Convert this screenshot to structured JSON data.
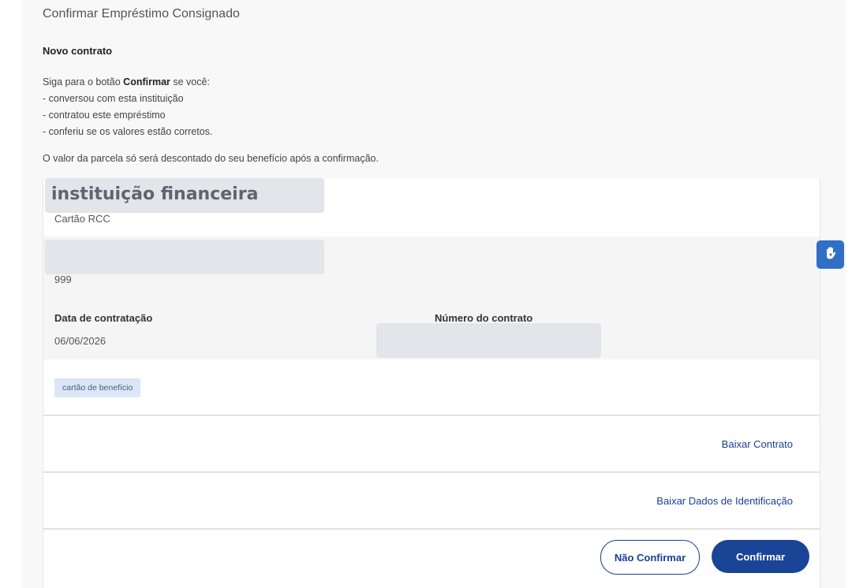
{
  "page": {
    "title": "Confirmar Empréstimo Consignado",
    "subtitle": "Novo contrato"
  },
  "instructions": {
    "lead_prefix": "Siga para o botão ",
    "lead_bold": "Confirmar",
    "lead_suffix": " se você:",
    "items": [
      "- conversou com esta instituição",
      "- contratou este empréstimo",
      "- conferiu se os valores estão corretos."
    ],
    "note": "O valor da parcela só será descontado do seu benefício após a confirmação."
  },
  "contract": {
    "institution_label": "instituição financeira",
    "product": "Cartão RCC",
    "code": "999",
    "date_label": "Data de contratação",
    "date_value": "06/06/2026",
    "number_label": "Número do contrato",
    "tag": "cartão de benefício"
  },
  "actions": {
    "download_contract": "Baixar Contrato",
    "download_identification": "Baixar Dados de Identificação",
    "reject": "Não Confirmar",
    "confirm": "Confirmar"
  },
  "colors": {
    "primary": "#1a4597",
    "link": "#1a3f95",
    "tag_bg": "#dbe6f6",
    "accessibility_button": "#2f6fc4"
  },
  "icons": {
    "accessibility": "hand-accessibility-icon"
  }
}
